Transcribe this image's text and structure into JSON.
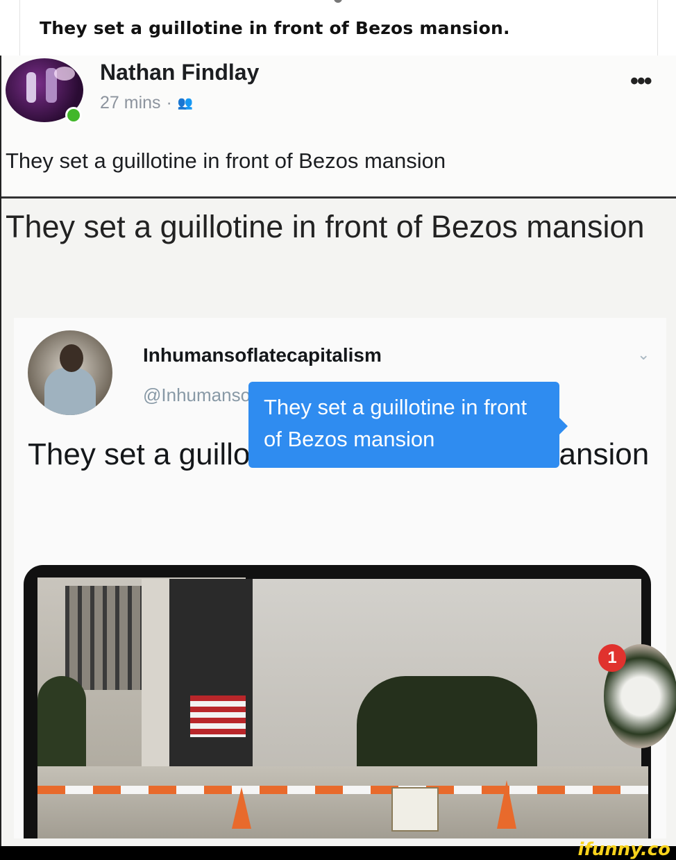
{
  "page": {
    "title": "They set a guillotine in front of Bezos mansion."
  },
  "facebook_post": {
    "poster_name": "Nathan Findlay",
    "timestamp": "27 mins",
    "separator": "·",
    "group_icon": "group-icon",
    "more_label": "•••",
    "text": "They set a guillotine in front of Bezos mansion"
  },
  "headline": {
    "text": "They set a guillotine in front of Bezos mansion"
  },
  "tweet": {
    "name": "Inhumansoflatecapitalism",
    "handle": "@Inhumansoflate1",
    "chevron": "⌄",
    "text": "They set a guillotine in front of bezos mansion"
  },
  "photo": {
    "caption_bubble": "They set a guillotine in front of Bezos mansion",
    "notification_count": "1"
  },
  "watermark": {
    "text": "ifunny.co"
  },
  "colors": {
    "online": "#42b72a",
    "bubble": "#2f8cf0",
    "badge": "#e0322e",
    "watermark": "#f7d21c"
  }
}
